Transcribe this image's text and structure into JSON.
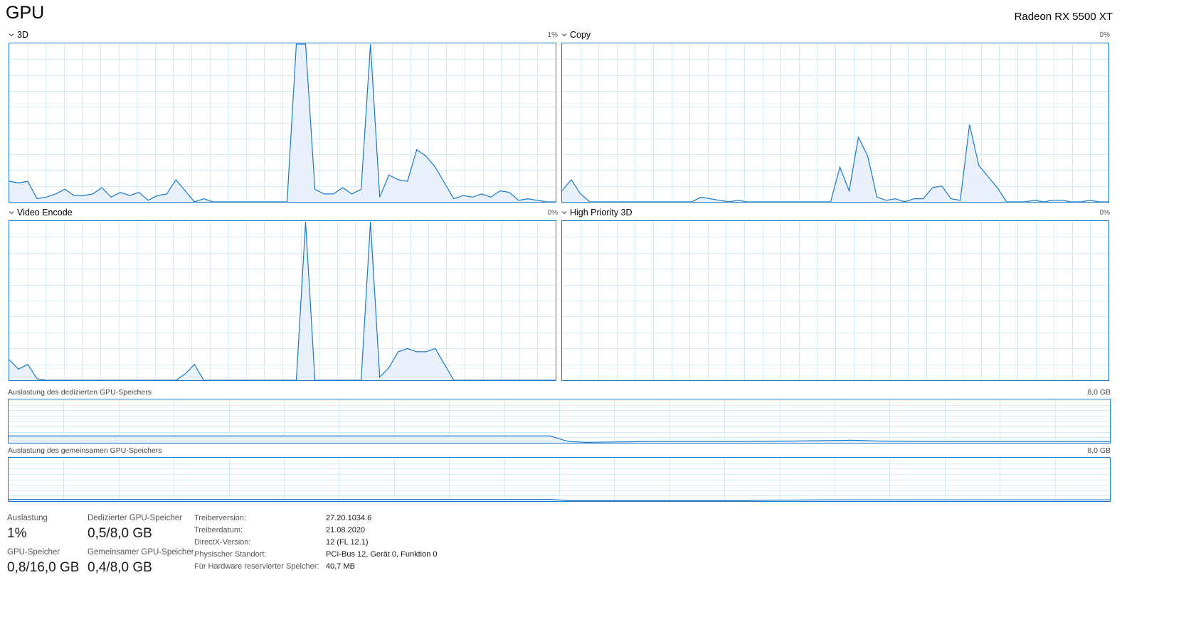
{
  "header": {
    "title": "GPU",
    "device": "Radeon RX 5500 XT"
  },
  "colors": {
    "line": "#1979ca",
    "fill": "#e8f1fa",
    "grid": "#d9eaf7",
    "border": "#1979ca"
  },
  "engines": [
    {
      "name": "3D",
      "percent": "1%",
      "icon": "chevron-down-icon",
      "points": [
        0,
        13,
        1,
        12,
        2,
        13,
        3,
        2,
        4,
        3,
        5,
        5,
        6,
        8,
        7,
        4,
        8,
        4,
        9,
        5,
        10,
        9,
        11,
        3,
        12,
        6,
        13,
        4,
        14,
        6,
        15,
        1,
        16,
        4,
        17,
        5,
        18,
        14,
        19,
        7,
        20,
        0,
        21,
        2,
        22,
        0,
        23,
        0,
        24,
        0,
        25,
        0,
        26,
        0,
        27,
        0,
        28,
        0,
        29,
        0,
        30,
        0,
        31,
        100,
        32,
        100,
        33,
        8,
        34,
        5,
        35,
        5,
        36,
        9,
        37,
        5,
        38,
        8,
        39,
        100,
        40,
        3,
        41,
        17,
        42,
        14,
        43,
        13,
        44,
        33,
        45,
        29,
        46,
        22,
        47,
        12,
        48,
        2,
        49,
        4,
        50,
        3,
        51,
        5,
        52,
        3,
        53,
        7,
        54,
        6,
        55,
        1,
        56,
        2,
        57,
        1,
        58,
        0,
        59,
        0
      ]
    },
    {
      "name": "Copy",
      "percent": "0%",
      "icon": "chevron-down-icon",
      "points": [
        0,
        7,
        1,
        14,
        2,
        5,
        3,
        0,
        4,
        0,
        5,
        0,
        6,
        0,
        7,
        0,
        8,
        0,
        9,
        0,
        10,
        0,
        11,
        0,
        12,
        0,
        13,
        0,
        14,
        0,
        15,
        3,
        16,
        2,
        17,
        1,
        18,
        0,
        19,
        1,
        20,
        0,
        21,
        0,
        22,
        0,
        23,
        0,
        24,
        0,
        25,
        0,
        26,
        0,
        27,
        0,
        28,
        0,
        29,
        0,
        30,
        22,
        31,
        7,
        32,
        41,
        33,
        29,
        34,
        3,
        35,
        1,
        36,
        2,
        37,
        0,
        38,
        2,
        39,
        2,
        40,
        9,
        41,
        10,
        42,
        2,
        43,
        1,
        44,
        49,
        45,
        23,
        46,
        16,
        47,
        9,
        48,
        0,
        49,
        0,
        50,
        0,
        51,
        1,
        52,
        0,
        53,
        1,
        54,
        1,
        55,
        0,
        56,
        0,
        57,
        1,
        58,
        0,
        59,
        0
      ]
    },
    {
      "name": "Video Encode",
      "percent": "0%",
      "icon": "chevron-down-icon",
      "points": [
        0,
        13,
        1,
        7,
        2,
        10,
        3,
        1,
        4,
        0,
        5,
        0,
        6,
        0,
        7,
        0,
        8,
        0,
        9,
        0,
        10,
        0,
        11,
        0,
        12,
        0,
        13,
        0,
        14,
        0,
        15,
        0,
        16,
        0,
        17,
        0,
        18,
        0,
        19,
        4,
        20,
        10,
        21,
        0,
        22,
        0,
        23,
        0,
        24,
        0,
        25,
        0,
        26,
        0,
        27,
        0,
        28,
        0,
        29,
        0,
        30,
        0,
        31,
        0,
        32,
        100,
        33,
        0,
        34,
        0,
        35,
        0,
        36,
        0,
        37,
        0,
        38,
        0,
        39,
        100,
        40,
        2,
        41,
        8,
        42,
        18,
        43,
        20,
        44,
        18,
        45,
        18,
        46,
        20,
        47,
        10,
        48,
        0,
        49,
        0,
        50,
        0,
        51,
        0,
        52,
        0,
        53,
        0,
        54,
        0,
        55,
        0,
        56,
        0,
        57,
        0,
        58,
        0,
        59,
        0
      ]
    },
    {
      "name": "High Priority 3D",
      "percent": "0%",
      "icon": "chevron-down-icon",
      "points": []
    }
  ],
  "memory": [
    {
      "label": "Auslastung des dedizierten GPU-Speichers",
      "max": "8,0 GB",
      "points": [
        0,
        16,
        59,
        16,
        61,
        3,
        63,
        1,
        66,
        2,
        70,
        3,
        80,
        3,
        85,
        4,
        92,
        6,
        95,
        4,
        100,
        3,
        110,
        3,
        120,
        3
      ]
    },
    {
      "label": "Auslastung des gemeinsamen GPU-Speichers",
      "max": "8,0 GB",
      "points": [
        0,
        4,
        59,
        4,
        61,
        1,
        80,
        1,
        83,
        2,
        90,
        3,
        100,
        3,
        110,
        3,
        120,
        3
      ]
    }
  ],
  "stats": {
    "utilization": {
      "label": "Auslastung",
      "value": "1%"
    },
    "dedicated": {
      "label": "Dedizierter GPU-Speicher",
      "value": "0,5/8,0 GB"
    },
    "gpu_memory": {
      "label": "GPU-Speicher",
      "value": "0,8/16,0 GB"
    },
    "shared": {
      "label": "Gemeinsamer GPU-Speicher",
      "value": "0,4/8,0 GB"
    }
  },
  "info": [
    {
      "key": "Treiberversion:",
      "value": "27.20.1034.6"
    },
    {
      "key": "Treiberdatum:",
      "value": "21.08.2020"
    },
    {
      "key": "DirectX-Version:",
      "value": "12 (FL 12.1)"
    },
    {
      "key": "Physischer Standort:",
      "value": "PCI-Bus 12, Gerät 0, Funktion 0"
    },
    {
      "key": "Für Hardware reservierter Speicher:",
      "value": "40,7 MB"
    }
  ]
}
